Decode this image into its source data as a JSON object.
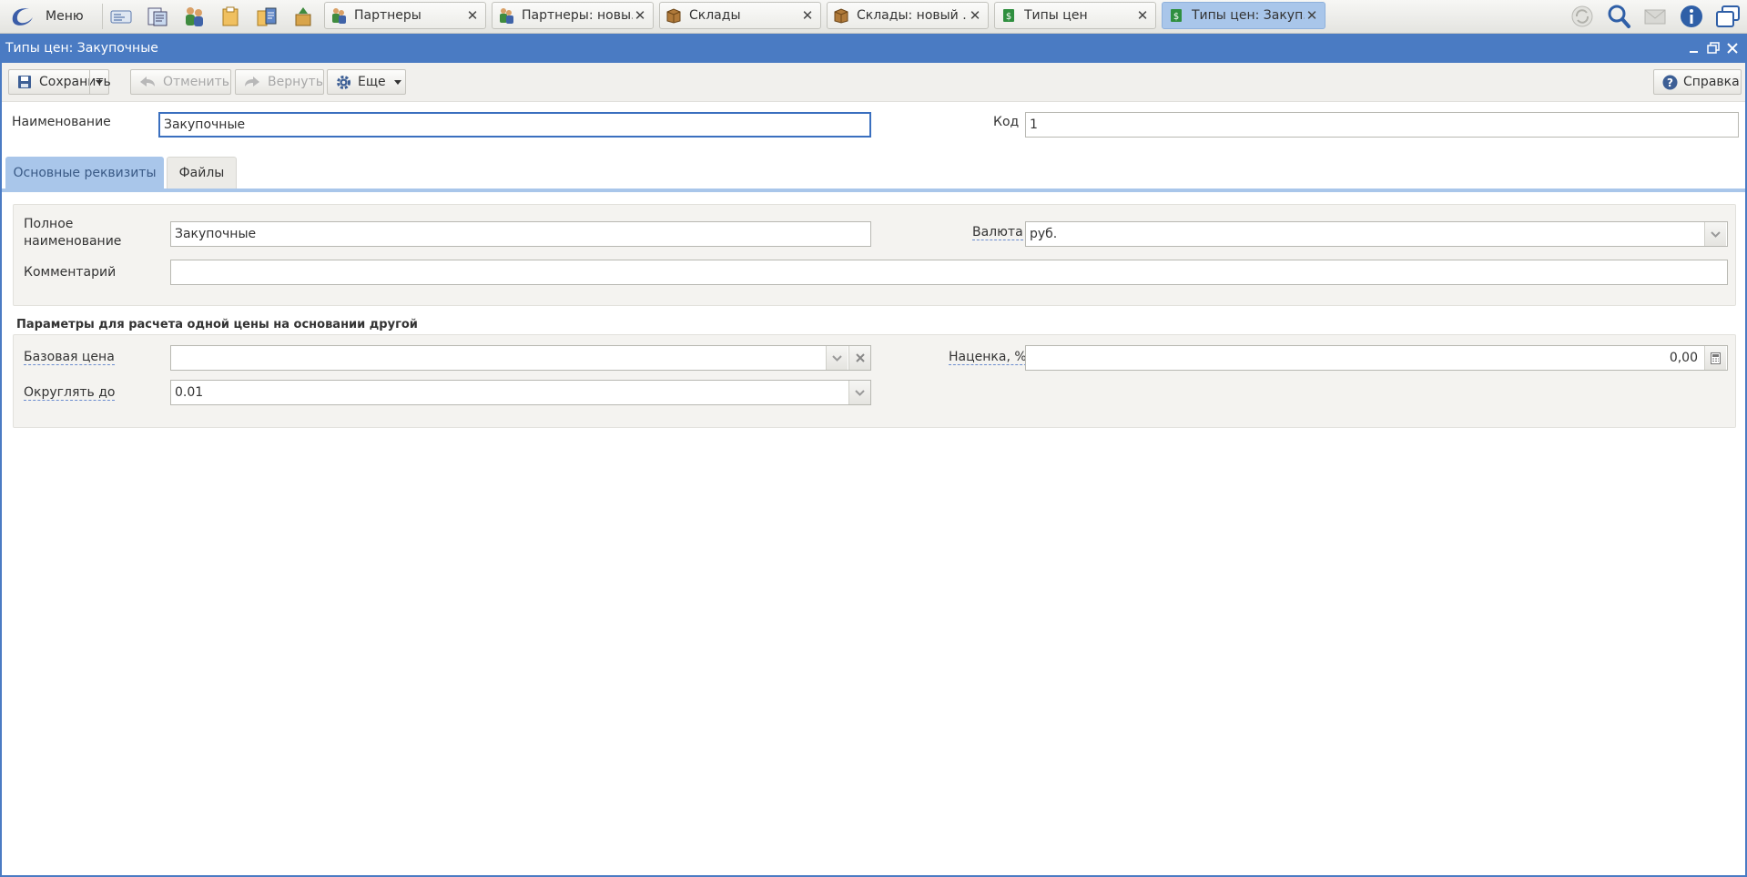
{
  "taskbar": {
    "menu_label": "Меню",
    "quick_icons": [
      "news-icon",
      "documents-icon",
      "partners-icon",
      "packages-icon",
      "clipboard-icon",
      "products-icon"
    ],
    "tabs": [
      {
        "label": "Партнеры",
        "icon": "partners-icon",
        "active": false
      },
      {
        "label": "Партнеры: новы...",
        "icon": "partners-icon",
        "active": false
      },
      {
        "label": "Склады",
        "icon": "warehouse-box-icon",
        "active": false
      },
      {
        "label": "Склады: новый ...",
        "icon": "warehouse-box-icon",
        "active": false
      },
      {
        "label": "Типы цен",
        "icon": "price-type-icon",
        "active": false
      },
      {
        "label": "Типы цен: Закуп...",
        "icon": "price-type-icon",
        "active": true
      }
    ],
    "right_icons": [
      "refresh-icon",
      "search-icon",
      "mail-icon",
      "info-icon",
      "windows-icon"
    ]
  },
  "window": {
    "title": "Типы цен: Закупочные"
  },
  "toolbar": {
    "save_label": "Сохранить",
    "cancel_label": "Отменить",
    "redo_label": "Вернуть",
    "more_label": "Еще",
    "help_label": "Справка"
  },
  "header": {
    "name_label": "Наименование",
    "name_value": "Закупочные",
    "code_label": "Код",
    "code_value": "1"
  },
  "tabs": [
    {
      "label": "Основные реквизиты",
      "active": true
    },
    {
      "label": "Файлы",
      "active": false
    }
  ],
  "main": {
    "full_name_label_line1": "Полное",
    "full_name_label_line2": "наименование",
    "full_name_value": "Закупочные",
    "currency_label": "Валюта",
    "currency_value": "руб.",
    "comment_label": "Комментарий",
    "comment_value": ""
  },
  "calc": {
    "title": "Параметры для расчета одной цены на основании другой",
    "base_price_label": "Базовая цена",
    "base_price_value": "",
    "markup_label": "Наценка, %",
    "markup_value": "0,00",
    "round_label": "Округлять до",
    "round_value": "0.01"
  },
  "colors": {
    "accent": "#4a7bc3",
    "tab_active": "#a9c6ea",
    "group_bg": "#f4f3f0"
  }
}
